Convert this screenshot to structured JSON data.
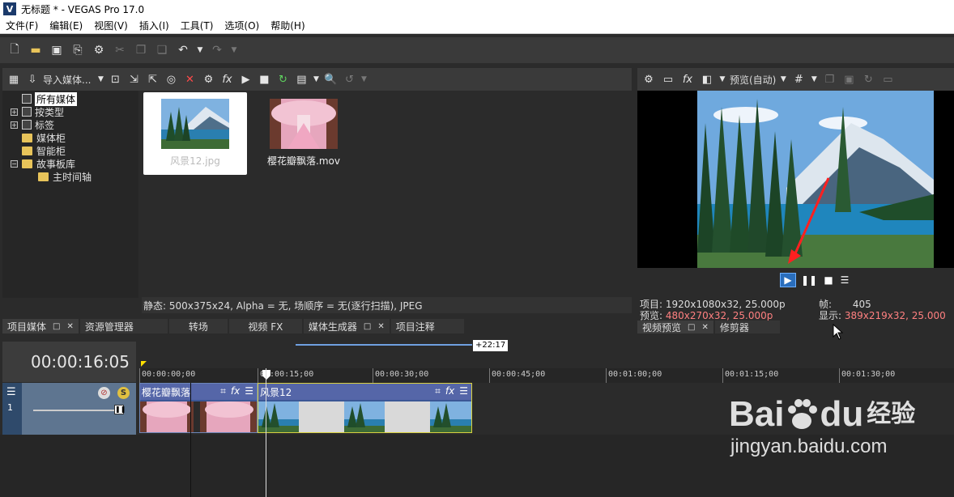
{
  "window": {
    "app_icon_letter": "V",
    "title": "无标题 * - VEGAS Pro 17.0"
  },
  "menu": [
    "文件(F)",
    "编辑(E)",
    "视图(V)",
    "插入(I)",
    "工具(T)",
    "选项(O)",
    "帮助(H)"
  ],
  "main_toolbar": {
    "icons": [
      "new-file-icon",
      "open-folder-icon",
      "save-icon",
      "render-icon",
      "settings-gear-icon",
      "cut-icon",
      "copy-icon",
      "paste-icon",
      "undo-icon",
      "undo-dropdown-icon",
      "redo-icon",
      "redo-dropdown-icon"
    ]
  },
  "media_panel": {
    "import_label": "导入媒体...",
    "tree": [
      {
        "label": "所有媒体",
        "selected": true,
        "expander": ""
      },
      {
        "label": "按类型",
        "expander": "+"
      },
      {
        "label": "标签",
        "expander": "+"
      },
      {
        "label": "媒体柜",
        "expander": ""
      },
      {
        "label": "智能柜",
        "expander": ""
      },
      {
        "label": "故事板库",
        "expander": "−"
      },
      {
        "label": "主时间轴",
        "expander": ""
      }
    ],
    "items": [
      {
        "caption": "风景12.jpg",
        "selected": true
      },
      {
        "caption": "樱花瓣飘落.mov",
        "selected": false
      }
    ],
    "status": "静态: 500x375x24, Alpha = 无, 场顺序 = 无(逐行扫描), JPEG",
    "tabs": [
      "项目媒体",
      "资源管理器",
      "转场",
      "视频 FX",
      "媒体生成器",
      "项目注释"
    ]
  },
  "preview_panel": {
    "mode_label": "预览(自动)",
    "info": {
      "project_label": "项目:",
      "project_value": "1920x1080x32, 25.000p",
      "preview_label": "预览:",
      "preview_value": "480x270x32, 25.000p",
      "frame_label": "帧:",
      "frame_value": "405",
      "display_label": "显示:",
      "display_value": "389x219x32, 25.000"
    },
    "tabs": [
      "视频预览",
      "修剪器"
    ]
  },
  "timeline": {
    "time_display": "00:00:16:05",
    "loop_label": "+22:17",
    "ruler_labels": [
      "00:00:00;00",
      "00:00:15;00",
      "00:00:30;00",
      "00:00:45;00",
      "00:01:00;00",
      "00:01:15;00",
      "00:01:30;00"
    ],
    "track_number": "1",
    "events": [
      {
        "name": "樱花瓣飘落"
      },
      {
        "name": "风景12"
      }
    ]
  },
  "watermark": {
    "brand_bai": "Bai",
    "brand_du": "du",
    "cn": "经验",
    "url": "jingyan.baidu.com"
  },
  "colors": {
    "accent": "#2a6ebd",
    "track_header": "#5e7590",
    "event_head": "#5566a8",
    "red_text": "#ff8080"
  }
}
